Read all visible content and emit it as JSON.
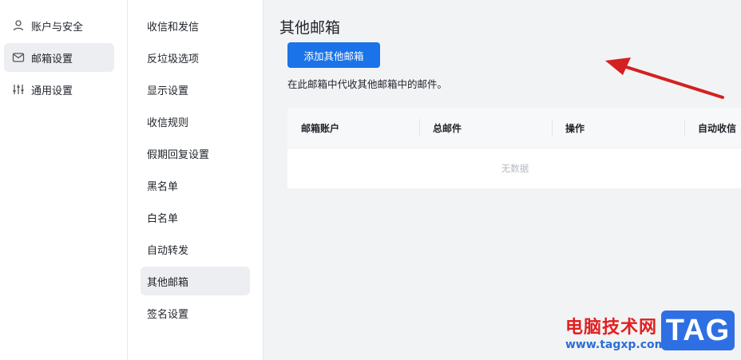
{
  "sidebar": {
    "items": [
      {
        "label": "账户与安全",
        "icon": "user-icon"
      },
      {
        "label": "邮箱设置",
        "icon": "mailbox-settings-icon",
        "active": true
      },
      {
        "label": "通用设置",
        "icon": "sliders-icon"
      }
    ]
  },
  "submenu": {
    "items": [
      {
        "label": "收信和发信"
      },
      {
        "label": "反垃圾选项"
      },
      {
        "label": "显示设置"
      },
      {
        "label": "收信规则"
      },
      {
        "label": "假期回复设置"
      },
      {
        "label": "黑名单"
      },
      {
        "label": "白名单"
      },
      {
        "label": "自动转发"
      },
      {
        "label": "其他邮箱",
        "active": true
      },
      {
        "label": "签名设置"
      }
    ]
  },
  "main": {
    "title": "其他邮箱",
    "add_button": "添加其他邮箱",
    "description": "在此邮箱中代收其他邮箱中的邮件。",
    "table": {
      "columns": [
        "邮箱账户",
        "总邮件",
        "操作",
        "自动收信"
      ],
      "empty_text": "无数据"
    }
  },
  "watermark": {
    "site_name": "电脑技术网",
    "url": "www.tagxp.com",
    "tag": "TAG"
  },
  "colors": {
    "accent": "#1a73e8",
    "arrow": "#d42020",
    "active_bg": "#eceef1"
  }
}
